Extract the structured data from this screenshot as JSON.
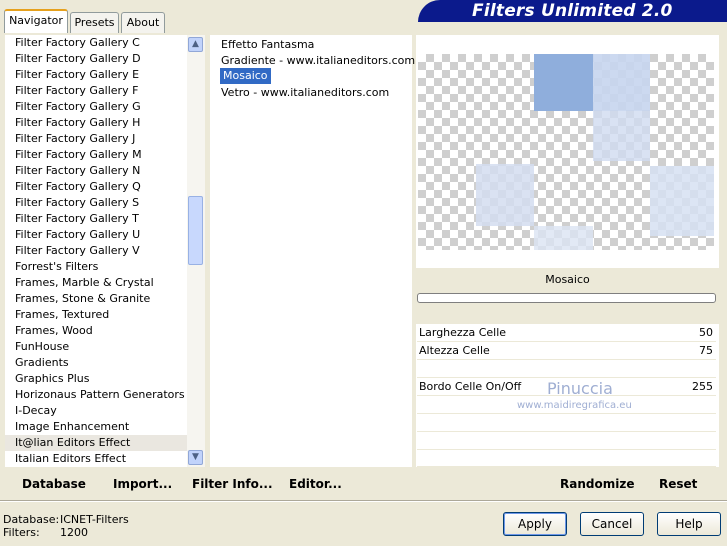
{
  "header": {
    "title": "Filters Unlimited 2.0"
  },
  "tabs": [
    "Navigator",
    "Presets",
    "About"
  ],
  "categories": [
    "Filter Factory Gallery C",
    "Filter Factory Gallery D",
    "Filter Factory Gallery E",
    "Filter Factory Gallery F",
    "Filter Factory Gallery G",
    "Filter Factory Gallery H",
    "Filter Factory Gallery J",
    "Filter Factory Gallery M",
    "Filter Factory Gallery N",
    "Filter Factory Gallery Q",
    "Filter Factory Gallery S",
    "Filter Factory Gallery T",
    "Filter Factory Gallery U",
    "Filter Factory Gallery V",
    "Forrest's Filters",
    "Frames, Marble & Crystal",
    "Frames, Stone & Granite",
    "Frames, Textured",
    "Frames, Wood",
    "FunHouse",
    "Gradients",
    "Graphics Plus",
    "Horizonaus Pattern Generators",
    "I-Decay",
    "Image Enhancement",
    "It@lian Editors Effect",
    "Italian Editors Effect"
  ],
  "selected_category": "It@lian Editors Effect",
  "filters": [
    "Effetto Fantasma",
    "Gradiente - www.italianeditors.com",
    "Mosaico",
    "Vetro - www.italianeditors.com"
  ],
  "selected_filter": "Mosaico",
  "filter_name": "Mosaico",
  "params": [
    {
      "label": "Larghezza Celle",
      "value": "50"
    },
    {
      "label": "Altezza Celle",
      "value": "75"
    },
    {
      "label": "Bordo Celle On/Off",
      "value": "255"
    }
  ],
  "watermark": {
    "name": "Pinuccia",
    "site": "www.maidiregrafica.eu"
  },
  "bottom_links": {
    "database": "Database",
    "import": "Import...",
    "filter_info": "Filter Info...",
    "editor": "Editor...",
    "randomize": "Randomize",
    "reset": "Reset"
  },
  "status": {
    "database_label": "Database:",
    "database_value": "ICNET-Filters",
    "filters_label": "Filters:",
    "filters_value": "1200"
  },
  "buttons": {
    "apply": "Apply",
    "cancel": "Cancel",
    "help": "Help"
  }
}
